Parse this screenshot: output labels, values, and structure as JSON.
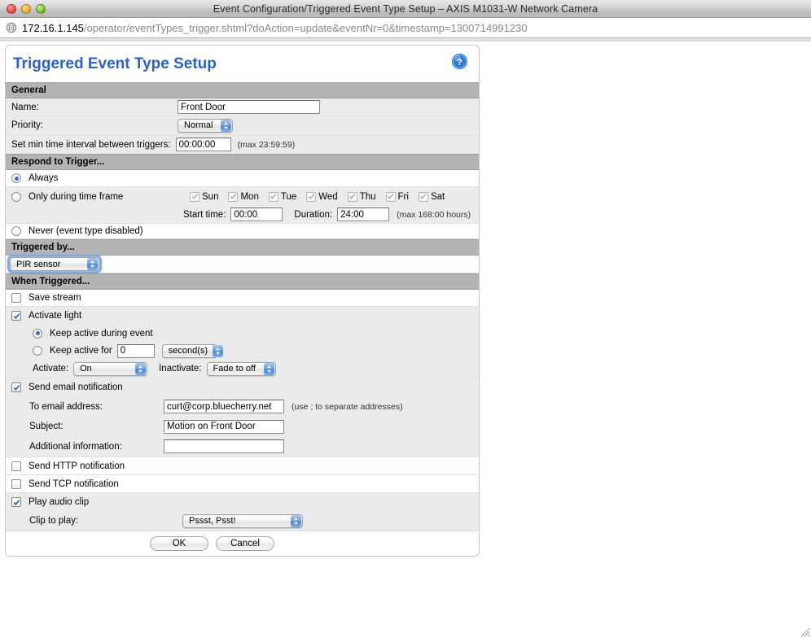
{
  "window": {
    "title": "Event Configuration/Triggered Event Type Setup – AXIS M1031-W Network Camera",
    "lights": {
      "close": "close-button",
      "minimize": "minimize-button",
      "maximize": "maximize-button"
    }
  },
  "urlbar": {
    "host": "172.16.1.145",
    "path": "/operator/eventTypes_trigger.shtml?doAction=update&eventNr=0&timestamp=1300714991230"
  },
  "panel": {
    "title": "Triggered Event Type Setup",
    "help_icon": "help-icon"
  },
  "general": {
    "header": "General",
    "name_label": "Name:",
    "name_value": "Front Door",
    "priority_label": "Priority:",
    "priority_value": "Normal",
    "interval_label": "Set min time interval between triggers:",
    "interval_value": "00:00:00",
    "interval_hint": "(max 23:59:59)"
  },
  "respond": {
    "header": "Respond to Trigger...",
    "always_label": "Always",
    "always_selected": true,
    "timeframe_label": "Only during time frame",
    "timeframe_selected": false,
    "days": [
      {
        "label": "Sun",
        "checked": true
      },
      {
        "label": "Mon",
        "checked": true
      },
      {
        "label": "Tue",
        "checked": true
      },
      {
        "label": "Wed",
        "checked": true
      },
      {
        "label": "Thu",
        "checked": true
      },
      {
        "label": "Fri",
        "checked": true
      },
      {
        "label": "Sat",
        "checked": true
      }
    ],
    "start_label": "Start time:",
    "start_value": "00:00",
    "duration_label": "Duration:",
    "duration_value": "24:00",
    "duration_hint": "(max 168:00 hours)",
    "never_label": "Never (event type disabled)",
    "never_selected": false
  },
  "triggered_by": {
    "header": "Triggered by...",
    "source_value": "PIR sensor"
  },
  "when_triggered": {
    "header": "When Triggered...",
    "save_stream_label": "Save stream",
    "save_stream_checked": false,
    "activate_light_label": "Activate light",
    "activate_light_checked": true,
    "keep_active_during_label": "Keep active during event",
    "keep_active_during_selected": true,
    "keep_active_for_label": "Keep active for",
    "keep_active_for_selected": false,
    "keep_active_for_value": "0",
    "keep_active_unit": "second(s)",
    "activate_label": "Activate:",
    "activate_value": "On",
    "inactivate_label": "Inactivate:",
    "inactivate_value": "Fade to off"
  },
  "email": {
    "header_label": "Send email notification",
    "header_checked": true,
    "to_label": "To email address:",
    "to_value": "curt@corp.bluecherry.net",
    "to_hint": "(use ; to separate addresses)",
    "subject_label": "Subject:",
    "subject_value": "Motion on Front Door",
    "additional_label": "Additional information:",
    "additional_value": ""
  },
  "http": {
    "label": "Send HTTP notification",
    "checked": false
  },
  "tcp": {
    "label": "Send TCP notification",
    "checked": false
  },
  "audio": {
    "label": "Play audio clip",
    "checked": true,
    "clip_label": "Clip to play:",
    "clip_value": "Pssst, Psst!"
  },
  "actions": {
    "ok_label": "OK",
    "cancel_label": "Cancel"
  },
  "colors": {
    "title_blue": "#2b62c4",
    "section_header_bg": "#b4b4b4",
    "row_gray": "#ebebeb"
  }
}
